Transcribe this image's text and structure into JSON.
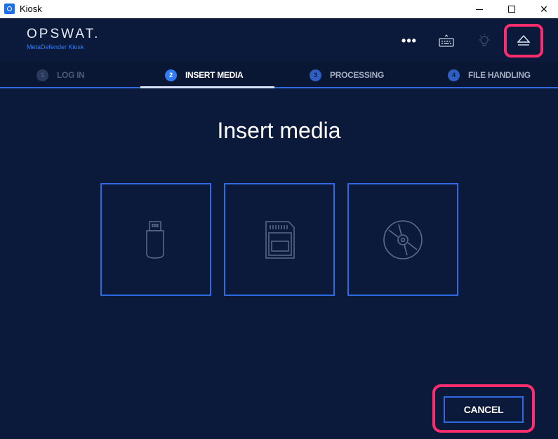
{
  "window": {
    "title": "Kiosk",
    "minimize_glyph": "",
    "close_glyph": "✕"
  },
  "header": {
    "brand": "OPSWAT.",
    "product": "MetaDefender Kiosk",
    "more_glyph": "•••",
    "icons": [
      "more-icon",
      "keyboard-icon",
      "lightbulb-icon",
      "eject-icon"
    ]
  },
  "steps": [
    {
      "num": "1",
      "label": "LOG IN",
      "state": "done"
    },
    {
      "num": "2",
      "label": "INSERT MEDIA",
      "state": "active"
    },
    {
      "num": "3",
      "label": "PROCESSING",
      "state": "pending"
    },
    {
      "num": "4",
      "label": "FILE HANDLING",
      "state": "pending"
    }
  ],
  "main": {
    "title": "Insert media",
    "media_options": [
      "usb-drive-icon",
      "sd-card-icon",
      "cd-disc-icon"
    ]
  },
  "footer": {
    "cancel_label": "CANCEL"
  },
  "colors": {
    "background": "#0b1a3a",
    "accent": "#2f7cf6",
    "highlight": "#ff2d6e"
  }
}
